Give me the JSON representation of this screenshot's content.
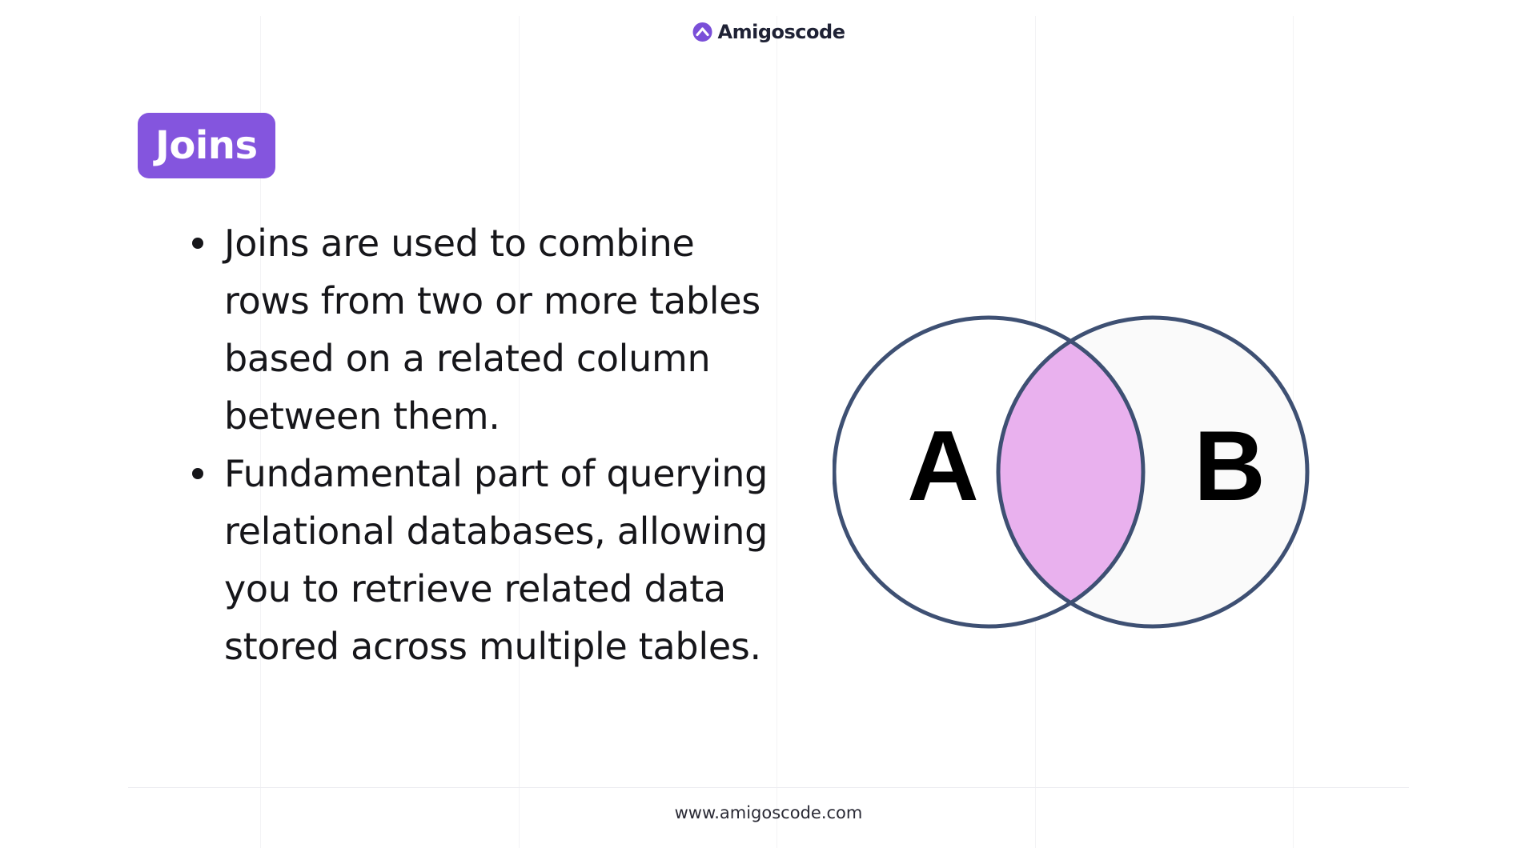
{
  "header": {
    "brand_name": "Amigoscode",
    "logo_icon": "amigoscode-logo-icon"
  },
  "title_badge": {
    "label": "Joins",
    "color": "#8455de"
  },
  "bullets": [
    "Joins are used to combine rows from two or more tables based on a related column between them.",
    "Fundamental part of querying relational databases, allowing you to retrieve related data stored across multiple tables."
  ],
  "venn": {
    "label_a": "A",
    "label_b": "B",
    "intersection_color": "#e9b1ee",
    "stroke_color": "#3e5073",
    "circle_b_fill": "#fafafa"
  },
  "footer": {
    "url": "www.amigoscode.com"
  }
}
